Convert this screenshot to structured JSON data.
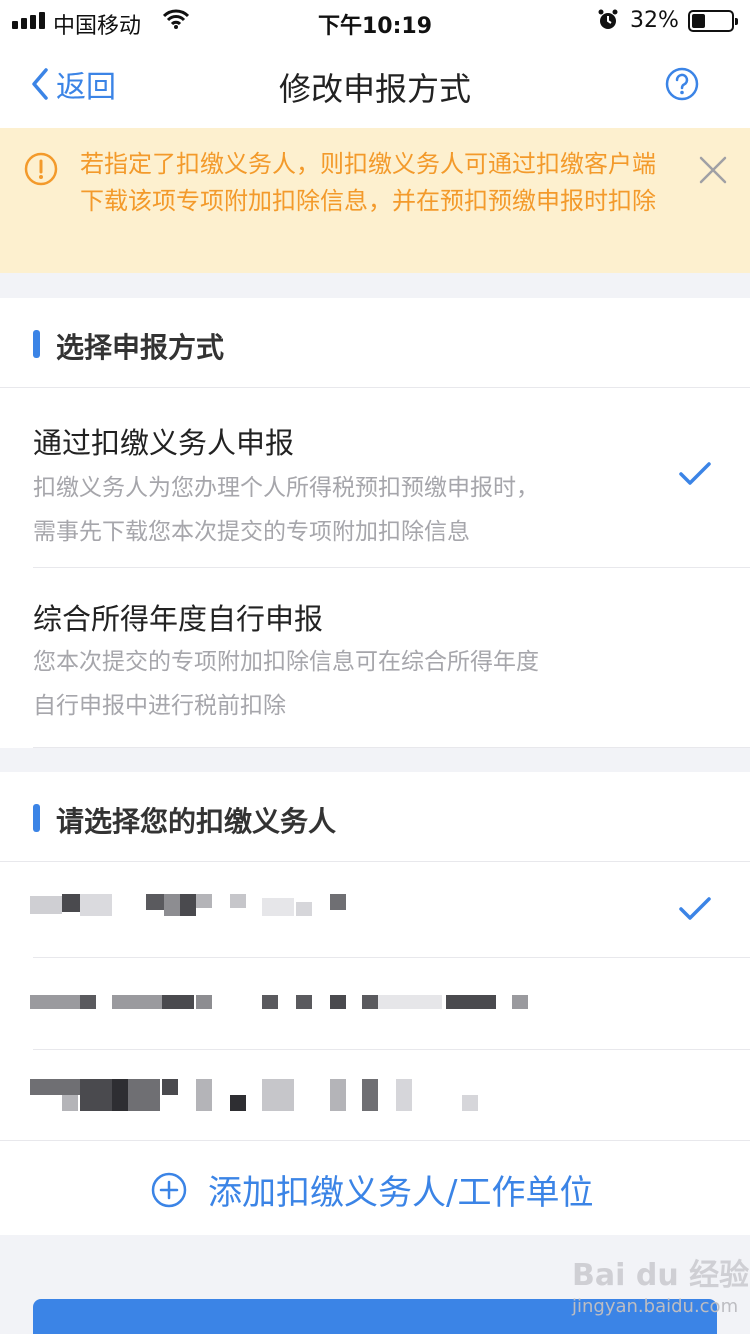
{
  "status_bar": {
    "carrier": "中国移动",
    "time": "下午10:19",
    "battery_percent": "32%"
  },
  "nav": {
    "back_label": "返回",
    "title": "修改申报方式"
  },
  "notice": {
    "text": "若指定了扣缴义务人，则扣缴义务人可通过扣缴客户端下载该项专项附加扣除信息，并在预扣预缴申报时扣除"
  },
  "method_section": {
    "heading": "选择申报方式",
    "options": [
      {
        "title": "通过扣缴义务人申报",
        "desc_line1": "扣缴义务人为您办理个人所得税预扣预缴申报时，",
        "desc_line2": "需事先下载您本次提交的专项附加扣除信息",
        "selected": true
      },
      {
        "title": "综合所得年度自行申报",
        "desc_line1": "您本次提交的专项附加扣除信息可在综合所得年度",
        "desc_line2": "自行申报中进行税前扣除",
        "selected": false
      }
    ]
  },
  "agent_section": {
    "heading": "请选择您的扣缴义务人",
    "agents": [
      {
        "selected": true
      },
      {
        "selected": false
      },
      {
        "selected": false
      }
    ],
    "add_label": "添加扣缴义务人/工作单位"
  },
  "watermark": {
    "brand": "Bai du 经验",
    "site": "jingyan.baidu.com"
  },
  "colors": {
    "accent": "#3b84e6",
    "notice_bg": "#fdf0cf",
    "notice_text": "#f39a2b"
  }
}
